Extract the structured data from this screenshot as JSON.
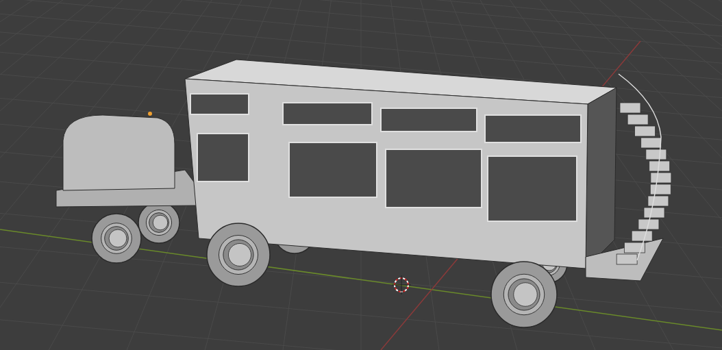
{
  "viewport": {
    "grid": true,
    "axes": true,
    "cursor": true,
    "origin": true
  }
}
